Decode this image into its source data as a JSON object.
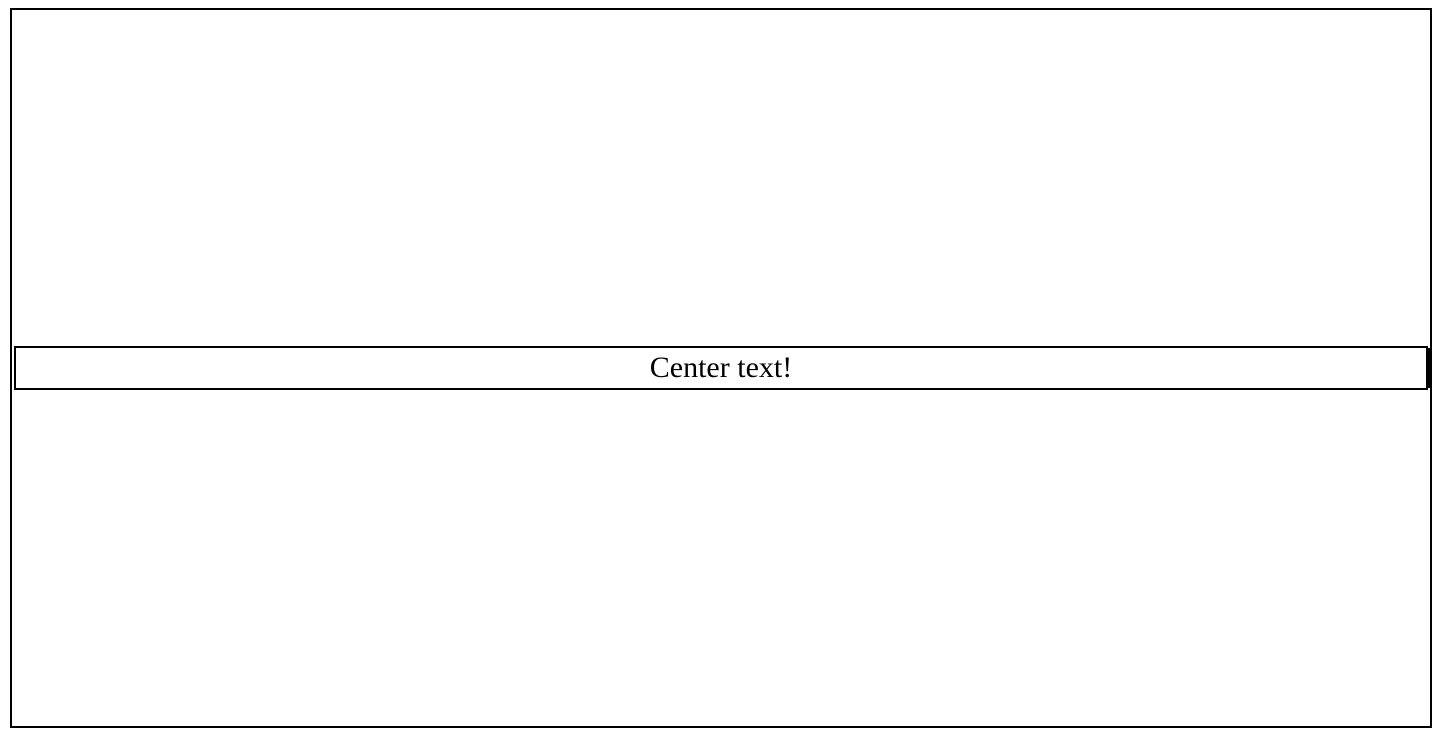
{
  "center": {
    "text": "Center text!"
  }
}
